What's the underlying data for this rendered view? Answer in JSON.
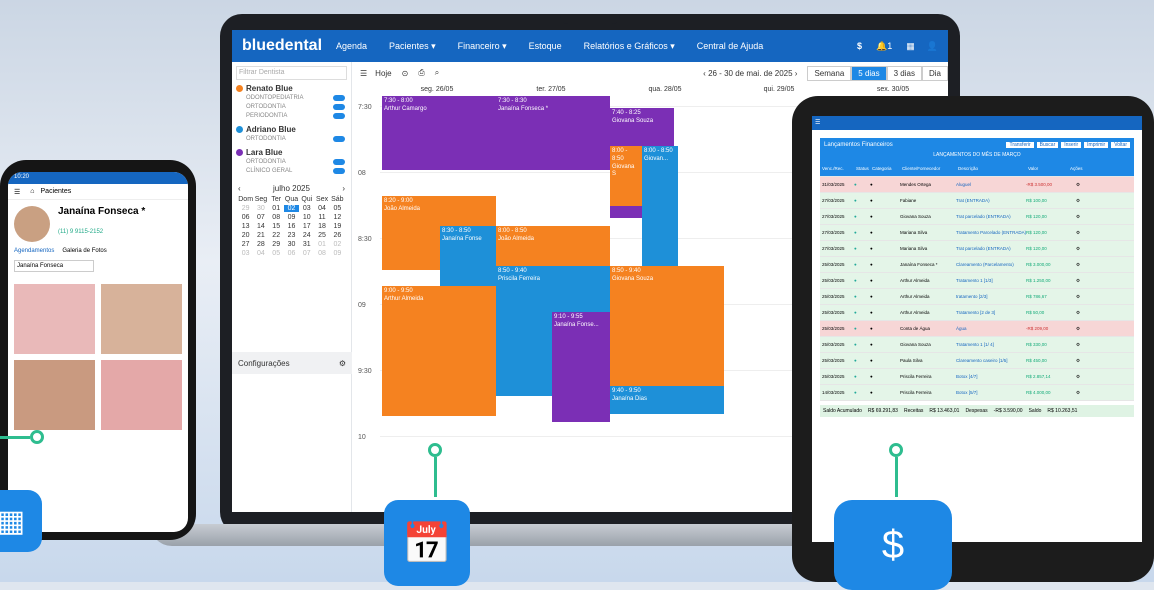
{
  "brand": "bluedental",
  "nav": [
    "Agenda",
    "Pacientes ▾",
    "Financeiro ▾",
    "Estoque",
    "Relatórios e Gráficos ▾",
    "Central de Ajuda"
  ],
  "nav_right": {
    "currency": "$",
    "notif_count": "1"
  },
  "search_placeholder": "Filtrar Dentista",
  "dentists": [
    {
      "name": "Renato Blue",
      "color": "#f58220",
      "specs": [
        "ODONTOPEDIATRIA",
        "ORTODONTIA",
        "PERIODONTIA"
      ]
    },
    {
      "name": "Adriano Blue",
      "color": "#1e90d8",
      "specs": [
        "ORTODONTIA"
      ]
    },
    {
      "name": "Lara Blue",
      "color": "#7b2fb5",
      "specs": [
        "ORTODONTIA",
        "CLÍNICO GERAL"
      ]
    }
  ],
  "minical": {
    "month": "julho 2025",
    "weekdays": [
      "Dom",
      "Seg",
      "Ter",
      "Qua",
      "Qui",
      "Sex",
      "Sáb"
    ],
    "rows": [
      [
        "29",
        "30",
        "01",
        "02",
        "03",
        "04",
        "05"
      ],
      [
        "06",
        "07",
        "08",
        "09",
        "10",
        "11",
        "12"
      ],
      [
        "13",
        "14",
        "15",
        "16",
        "17",
        "18",
        "19"
      ],
      [
        "20",
        "21",
        "22",
        "23",
        "24",
        "25",
        "26"
      ],
      [
        "27",
        "28",
        "29",
        "30",
        "31",
        "01",
        "02"
      ],
      [
        "03",
        "04",
        "05",
        "06",
        "07",
        "08",
        "09"
      ]
    ]
  },
  "config_label": "Configurações",
  "toolbar": {
    "today": "Hoje",
    "range": "26 - 30 de mai. de 2025",
    "views": [
      "Semana",
      "5 dias",
      "3 dias",
      "Dia"
    ]
  },
  "days": [
    "seg. 26/05",
    "ter. 27/05",
    "qua. 28/05",
    "qui. 29/05",
    "sex. 30/05"
  ],
  "times": [
    "7:30",
    "08",
    "8:30",
    "09",
    "9:30",
    "10"
  ],
  "events": [
    {
      "time": "7:30 - 8:00",
      "name": "Arthur Camargo",
      "color": "purple"
    },
    {
      "time": "7:30 - 8:30",
      "name": "Janaína Fonseca *",
      "color": "purple"
    },
    {
      "time": "7:40 - 8:25",
      "name": "Giovana Souza",
      "color": "purple"
    },
    {
      "time": "8:00 - 8:50",
      "name": "Giovana S",
      "color": "orange"
    },
    {
      "time": "8:00 - 8:50",
      "name": "Giovan...",
      "color": "blue"
    },
    {
      "time": "8:20 - 9:00",
      "name": "João Almeida",
      "color": "orange"
    },
    {
      "time": "8:30 - 8:50",
      "name": "Janaína Fonse",
      "color": "blue"
    },
    {
      "time": "8:00 - 8:50",
      "name": "João Almeida",
      "color": "orange"
    },
    {
      "time": "8:50 - 9:40",
      "name": "Priscila Ferreira",
      "color": "blue"
    },
    {
      "time": "8:50 - 9:40",
      "name": "Giovana Souza",
      "color": "orange"
    },
    {
      "time": "9:00 - 9:50",
      "name": "Arthur Almeida",
      "color": "orange"
    },
    {
      "time": "9:10 - 9:55",
      "name": "Janaína Fonse...",
      "color": "purple"
    },
    {
      "time": "9:40 - 9:50",
      "name": "Janaína Dias",
      "color": "blue"
    }
  ],
  "phone": {
    "clock": "10:20",
    "title": "Pacientes",
    "patient": "Janaína Fonseca *",
    "phone": "(11) 9 9115-2152",
    "tab1": "Agendamentos",
    "tab2": "Galeria de Fotos",
    "select": "Janaína Fonseca"
  },
  "tablet": {
    "title": "Lançamentos Financeiros",
    "buttons": [
      "Transferir",
      "Buscar",
      "Inserir",
      "Imprimir",
      "Voltar"
    ],
    "subtitle": "LANÇAMENTOS DO MÊS DE MARÇO",
    "cols": [
      "Venc./Rec.",
      "Status",
      "Categoria",
      "Cliente/Fornecedor",
      "Descrição",
      "Valor",
      "Ações"
    ],
    "rows": [
      [
        "31/03/2025",
        "Mendes Ortega",
        "Aluguel",
        "-R$ 3.500,00"
      ],
      [
        "27/03/2025",
        "Fabiane",
        "Trat (ENTRADA)",
        "R$ 100,00"
      ],
      [
        "27/03/2025",
        "Giovana Souza",
        "Trat parcelado (ENTRADA)",
        "R$ 120,00"
      ],
      [
        "27/03/2025",
        "Mariana Silva",
        "Tratamento Parcelado (ENTRADA)",
        "R$ 120,00"
      ],
      [
        "27/03/2025",
        "Mariana Silva",
        "Trat parcelado (ENTRADA)",
        "R$ 120,00"
      ],
      [
        "25/03/2025",
        "Janaína Fonseca *",
        "Clareamento (Parcelamento)",
        "R$ 3.000,00"
      ],
      [
        "25/03/2025",
        "Arthur Almeida",
        "Tratamento 1 [1/3]",
        "R$ 1.250,00"
      ],
      [
        "25/03/2025",
        "Arthur Almeida",
        "tratamento [2/3]",
        "R$ 786,67"
      ],
      [
        "25/03/2025",
        "Arthur Almeida",
        "Tratamento [2 de 3]",
        "R$ 50,00"
      ],
      [
        "25/03/2025",
        "Conta de Água",
        "Água",
        "-R$ 209,00"
      ],
      [
        "25/03/2025",
        "Giovana Souza",
        "Tratamento 1 [1/ 4]",
        "R$ 330,00"
      ],
      [
        "25/03/2025",
        "Paula Silva",
        "Clareamento caseiro [1/5]",
        "R$ 450,00"
      ],
      [
        "25/03/2025",
        "Priscila Ferreira",
        "Botox [4/7]",
        "R$ 2.857,14"
      ],
      [
        "14/03/2025",
        "Priscila Ferreira",
        "Botox [5/7]",
        "R$ 4.000,00"
      ]
    ],
    "footer": {
      "saldo_label": "Saldo Acumulado",
      "saldo": "R$ 69.291,83",
      "receitas_label": "Receitas",
      "receitas": "R$ 13.463,01",
      "despesas_label": "Despesas",
      "despesas": "-R$ 3.590,00",
      "saldo2_label": "Saldo",
      "saldo2": "R$ 10.263,51"
    }
  }
}
